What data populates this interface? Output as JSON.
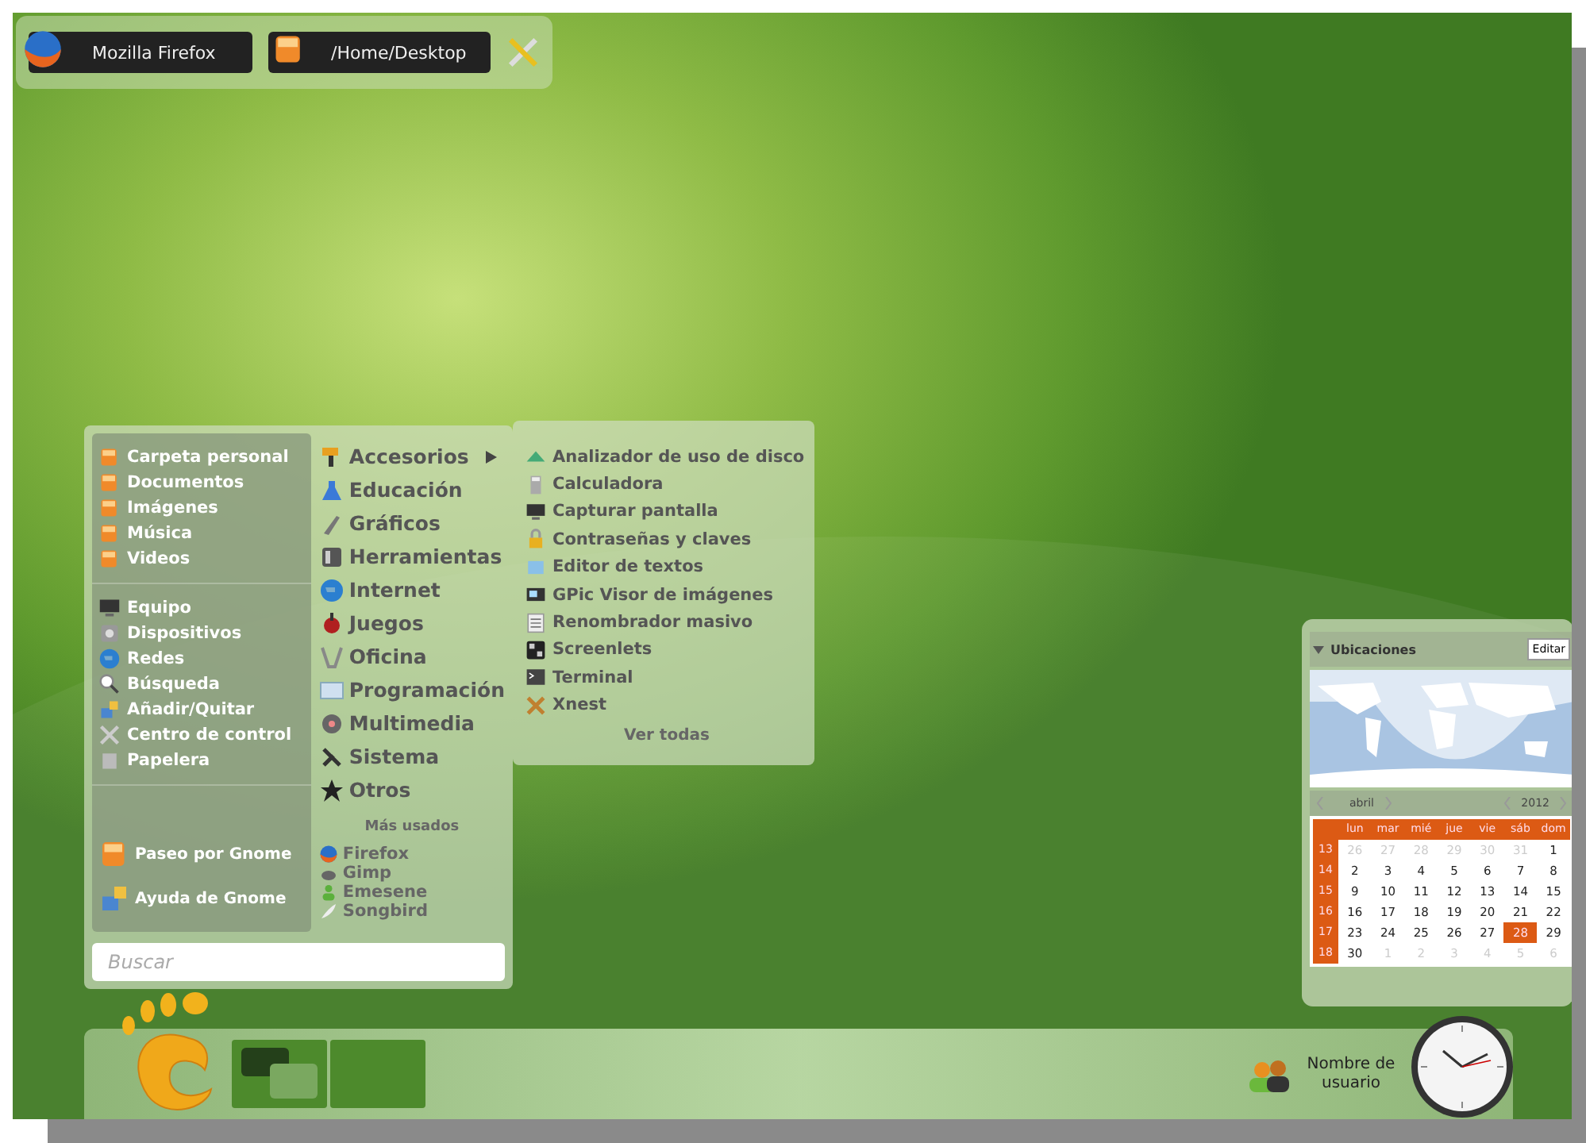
{
  "top_panel": {
    "launchers": [
      {
        "label": "Mozilla Firefox",
        "kind": "browser"
      },
      {
        "label": "/Home/Desktop",
        "kind": "folder"
      }
    ]
  },
  "menu": {
    "places": [
      {
        "label": "Carpeta personal"
      },
      {
        "label": "Documentos"
      },
      {
        "label": "Imágenes"
      },
      {
        "label": "Música"
      },
      {
        "label": "Videos"
      }
    ],
    "system": [
      {
        "label": "Equipo"
      },
      {
        "label": "Dispositivos"
      },
      {
        "label": "Redes"
      },
      {
        "label": "Búsqueda"
      },
      {
        "label": "Añadir/Quitar"
      },
      {
        "label": "Centro de control"
      },
      {
        "label": "Papelera"
      }
    ],
    "help": [
      {
        "label": "Paseo por Gnome"
      },
      {
        "label": "Ayuda de Gnome"
      }
    ],
    "categories": [
      {
        "label": "Accesorios",
        "expanded": true
      },
      {
        "label": "Educación",
        "expanded": false
      },
      {
        "label": "Gráficos",
        "expanded": false
      },
      {
        "label": "Herramientas",
        "expanded": false
      },
      {
        "label": "Internet",
        "expanded": false
      },
      {
        "label": "Juegos",
        "expanded": false
      },
      {
        "label": "Oficina",
        "expanded": false
      },
      {
        "label": "Programación",
        "expanded": false
      },
      {
        "label": "Multimedia",
        "expanded": false
      },
      {
        "label": "Sistema",
        "expanded": false
      },
      {
        "label": "Otros",
        "expanded": false
      }
    ],
    "most_used_title": "Más usados",
    "most_used": [
      {
        "label": "Firefox"
      },
      {
        "label": "Gimp"
      },
      {
        "label": "Emesene"
      },
      {
        "label": "Songbird"
      }
    ],
    "search": {
      "placeholder": "Buscar"
    }
  },
  "submenu": {
    "items": [
      {
        "label": "Analizador de uso de disco"
      },
      {
        "label": "Calculadora"
      },
      {
        "label": "Capturar pantalla"
      },
      {
        "label": "Contraseñas y claves"
      },
      {
        "label": "Editor de textos"
      },
      {
        "label": "GPic Visor de imágenes"
      },
      {
        "label": "Renombrador masivo"
      },
      {
        "label": "Screenlets"
      },
      {
        "label": "Terminal"
      },
      {
        "label": "Xnest"
      }
    ],
    "footer": "Ver todas"
  },
  "widget": {
    "title": "Ubicaciones",
    "expanded": true,
    "edit_button": "Editar",
    "calendar": {
      "month": "abril",
      "year": "2012",
      "weekdays": [
        "lun",
        "mar",
        "mié",
        "jue",
        "vie",
        "sáb",
        "dom"
      ],
      "weeks": [
        {
          "number": "13",
          "days": [
            {
              "day": "26",
              "other_month": true,
              "selected": false
            },
            {
              "day": "27",
              "other_month": true,
              "selected": false
            },
            {
              "day": "28",
              "other_month": true,
              "selected": false
            },
            {
              "day": "29",
              "other_month": true,
              "selected": false
            },
            {
              "day": "30",
              "other_month": true,
              "selected": false
            },
            {
              "day": "31",
              "other_month": true,
              "selected": false
            },
            {
              "day": "1",
              "other_month": false,
              "selected": false
            }
          ]
        },
        {
          "number": "14",
          "days": [
            {
              "day": "2",
              "other_month": false,
              "selected": false
            },
            {
              "day": "3",
              "other_month": false,
              "selected": false
            },
            {
              "day": "4",
              "other_month": false,
              "selected": false
            },
            {
              "day": "5",
              "other_month": false,
              "selected": false
            },
            {
              "day": "6",
              "other_month": false,
              "selected": false
            },
            {
              "day": "7",
              "other_month": false,
              "selected": false
            },
            {
              "day": "8",
              "other_month": false,
              "selected": false
            }
          ]
        },
        {
          "number": "15",
          "days": [
            {
              "day": "9",
              "other_month": false,
              "selected": false
            },
            {
              "day": "10",
              "other_month": false,
              "selected": false
            },
            {
              "day": "11",
              "other_month": false,
              "selected": false
            },
            {
              "day": "12",
              "other_month": false,
              "selected": false
            },
            {
              "day": "13",
              "other_month": false,
              "selected": false
            },
            {
              "day": "14",
              "other_month": false,
              "selected": false
            },
            {
              "day": "15",
              "other_month": false,
              "selected": false
            }
          ]
        },
        {
          "number": "16",
          "days": [
            {
              "day": "16",
              "other_month": false,
              "selected": false
            },
            {
              "day": "17",
              "other_month": false,
              "selected": false
            },
            {
              "day": "18",
              "other_month": false,
              "selected": false
            },
            {
              "day": "19",
              "other_month": false,
              "selected": false
            },
            {
              "day": "20",
              "other_month": false,
              "selected": false
            },
            {
              "day": "21",
              "other_month": false,
              "selected": false
            },
            {
              "day": "22",
              "other_month": false,
              "selected": false
            }
          ]
        },
        {
          "number": "17",
          "days": [
            {
              "day": "23",
              "other_month": false,
              "selected": false
            },
            {
              "day": "24",
              "other_month": false,
              "selected": false
            },
            {
              "day": "25",
              "other_month": false,
              "selected": false
            },
            {
              "day": "26",
              "other_month": false,
              "selected": false
            },
            {
              "day": "27",
              "other_month": false,
              "selected": false
            },
            {
              "day": "28",
              "other_month": false,
              "selected": true
            },
            {
              "day": "29",
              "other_month": false,
              "selected": false
            }
          ]
        },
        {
          "number": "18",
          "days": [
            {
              "day": "30",
              "other_month": false,
              "selected": false
            },
            {
              "day": "1",
              "other_month": true,
              "selected": false
            },
            {
              "day": "2",
              "other_month": true,
              "selected": false
            },
            {
              "day": "3",
              "other_month": true,
              "selected": false
            },
            {
              "day": "4",
              "other_month": true,
              "selected": false
            },
            {
              "day": "5",
              "other_month": true,
              "selected": false
            },
            {
              "day": "6",
              "other_month": true,
              "selected": false
            }
          ]
        }
      ]
    }
  },
  "bottom_panel": {
    "user": "Nombre de usuario"
  }
}
